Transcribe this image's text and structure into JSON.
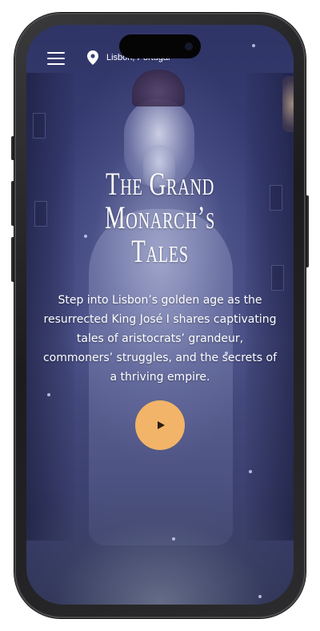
{
  "header": {
    "menu_icon": "hamburger-menu-icon",
    "location_icon": "location-pin-icon",
    "location_label": "Lisbon, Portugal"
  },
  "hero": {
    "title_line1": "The Grand",
    "title_line2": "Monarch’s",
    "title_line3": "Tales",
    "description": "Step into Lisbon’s golden age as the resurrected King José I shares captivating tales of aristocrats’ grandeur, commoners’ struggles, and the secrets of a thriving empire.",
    "play_icon": "play-icon"
  },
  "colors": {
    "accent": "#f2b468",
    "background_top": "#2f3466",
    "background_bottom": "#2a2e52",
    "text": "#ffffff"
  }
}
